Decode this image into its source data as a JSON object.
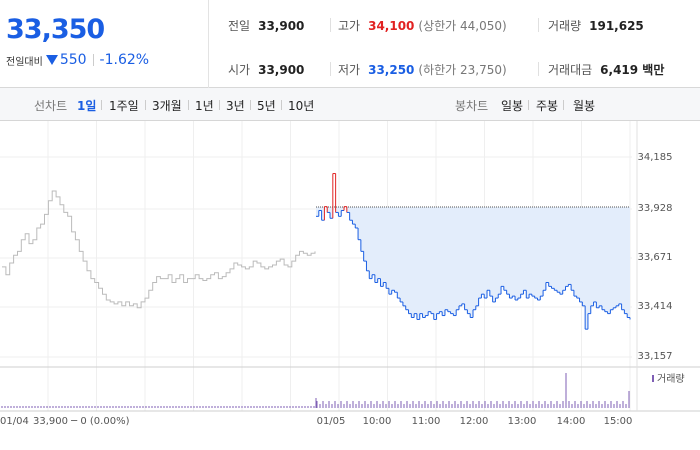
{
  "summary": {
    "current_price": "33,350",
    "change_label": "전일대비",
    "change_amount": "550",
    "change_percent": "-1.62%",
    "prev_close_label": "전일",
    "prev_close": "33,900",
    "high_label": "고가",
    "high": "34,100",
    "upper_limit": "(상한가 44,050)",
    "volume_label": "거래량",
    "volume": "191,625",
    "open_label": "시가",
    "open": "33,900",
    "low_label": "저가",
    "low": "33,250",
    "lower_limit": "(하한가 23,750)",
    "value_label": "거래대금",
    "value": "6,419 백만"
  },
  "tabs": {
    "line_chart_label": "선차트",
    "periods": [
      "1일",
      "1주일",
      "3개월",
      "1년",
      "3년",
      "5년",
      "10년"
    ],
    "active_period": "1일",
    "candle_chart_label": "봉차트",
    "candle_periods": [
      "일봉",
      "주봉",
      "월봉"
    ]
  },
  "colors": {
    "down": "#1a5ee3",
    "up": "#e12222",
    "prev_day_line": "#bbbbbb",
    "fill": "#e3edfb"
  },
  "chart_data": {
    "type": "line",
    "y_ticks": [
      "34,185",
      "33,928",
      "33,671",
      "33,414",
      "33,157"
    ],
    "ylim": [
      33157,
      34185
    ],
    "x_tick_labels": [
      "01/05",
      "10:00",
      "11:00",
      "12:00",
      "13:00",
      "14:00",
      "15:00"
    ],
    "prev_day_label": "01/04",
    "prev_day_summary": "33,900 ─ 0 (0.00%)",
    "volume_legend": "거래량",
    "reference_price": 33928,
    "series": [
      {
        "values": [
          33620,
          33580,
          33640,
          33680,
          33700,
          33760,
          33790,
          33740,
          33760,
          33820,
          33840,
          33890,
          33960,
          34010,
          33980,
          33940,
          33900,
          33880,
          33800,
          33760,
          33700,
          33650,
          33600,
          33560,
          33540,
          33510,
          33480,
          33450,
          33440,
          33430,
          33440,
          33420,
          33440,
          33420,
          33430,
          33410,
          33440,
          33460,
          33500,
          33540,
          33570,
          33560,
          33560,
          33580,
          33540,
          33560,
          33580,
          33540,
          33560,
          33560,
          33580,
          33560,
          33550,
          33560,
          33580,
          33590,
          33560,
          33570,
          33590,
          33610,
          33640,
          33630,
          33620,
          33610,
          33620,
          33650,
          33640,
          33620,
          33610,
          33620,
          33630,
          33650,
          33660,
          33630,
          33620,
          33650,
          33680,
          33700,
          33690,
          33680,
          33690,
          33700
        ]
      },
      {
        "values": [
          33880,
          33910,
          33860,
          33930,
          33900,
          33870,
          34100,
          33900,
          33880,
          33910,
          33930,
          33900,
          33860,
          33840,
          33820,
          33760,
          33700,
          33650,
          33600,
          33560,
          33580,
          33540,
          33560,
          33520,
          33540,
          33510,
          33480,
          33500,
          33490,
          33460,
          33440,
          33420,
          33400,
          33380,
          33360,
          33380,
          33350,
          33380,
          33360,
          33370,
          33390,
          33380,
          33350,
          33380,
          33390,
          33370,
          33400,
          33390,
          33380,
          33370,
          33400,
          33420,
          33430,
          33400,
          33380,
          33360,
          33400,
          33420,
          33460,
          33480,
          33460,
          33500,
          33470,
          33440,
          33460,
          33480,
          33520,
          33500,
          33480,
          33460,
          33470,
          33450,
          33460,
          33480,
          33500,
          33460,
          33480,
          33470,
          33460,
          33450,
          33470,
          33500,
          33540,
          33520,
          33510,
          33500,
          33490,
          33480,
          33500,
          33520,
          33530,
          33500,
          33470,
          33460,
          33440,
          33420,
          33300,
          33380,
          33420,
          33440,
          33410,
          33420,
          33400,
          33390,
          33380,
          33400,
          33410,
          33420,
          33430,
          33400,
          33380,
          33360,
          33350
        ]
      }
    ]
  }
}
